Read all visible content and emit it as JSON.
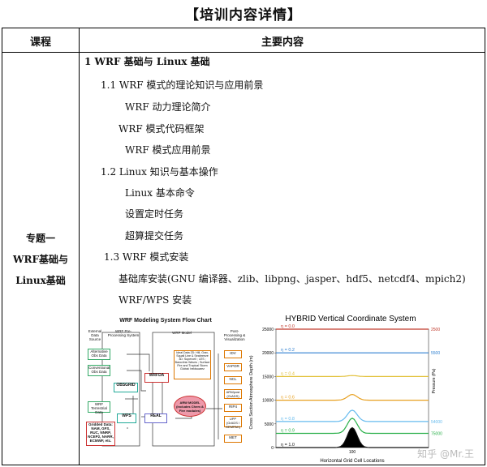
{
  "title": "【培训内容详情】",
  "table": {
    "col1_header": "课程",
    "col2_header": "主要内容",
    "course": [
      "专题一",
      "WRF基础与",
      "Linux基础"
    ],
    "lines": [
      {
        "text": "1 WRF 基础与 Linux 基础",
        "bold": true
      },
      {
        "text": "1.1 WRF 模式的理论知识与应用前景",
        "bold": false
      },
      {
        "text": "WRF 动力理论简介",
        "bold": false
      },
      {
        "text": "WRF 模式代码框架",
        "bold": false
      },
      {
        "text": "WRF 模式应用前景",
        "bold": false
      },
      {
        "text": "1.2 Linux 知识与基本操作",
        "bold": false
      },
      {
        "text": "Linux 基本命令",
        "bold": false
      },
      {
        "text": "设置定时任务",
        "bold": false
      },
      {
        "text": "超算提交任务",
        "bold": false
      },
      {
        "text": "1.3 WRF 模式安装",
        "bold": false
      },
      {
        "text": "基础库安装(GNU 编译器、zlib、libpng、jasper、hdf5、netcdf4、mpich2)",
        "bold": false
      },
      {
        "text": "WRF/WPS 安装",
        "bold": false
      }
    ]
  },
  "flowchart": {
    "title": "WRF Modeling System Flow Chart",
    "col_labels": [
      "External Data Source",
      "WRF Pre-Processing System",
      "WRF Model",
      "Post-Processing & Visualization"
    ],
    "boxes": [
      "Alternative Obs Data",
      "Conventional Obs Data",
      "WRF Terrestrial Data",
      "Gridded Data: NAM, GFS, RUC, NNRP, NCEP2, NARR, ECMWF, etc.",
      "OBSGRID",
      "WPS",
      "WRFDA",
      "REAL",
      "Ideal Data 2D: Hill, Grav, Squall Line & Seabreeze 3D: Supercell ; LES ; Baroclinic Waves ; Surface Fire and Tropical Storm Global: heldsuarez",
      "ARW MODEL (includes Chem & Fire modules)",
      "IDV",
      "VAPOR",
      "NCL",
      "ARWpost (GrADS)",
      "RIP4",
      "UPP (GrADS / GEMPAK)",
      "MET"
    ]
  },
  "chart_data": {
    "type": "line",
    "title": "HYBRID Vertical Coordinate System",
    "xlabel": "Horizontal Grid Cell Locations",
    "ylabel": "Cross Section Atmosphere Depth (m)",
    "ylabel_right": "Pressure (Pa)",
    "xlim": [
      0,
      200
    ],
    "ylim": [
      0,
      25000
    ],
    "yticks": [
      "0",
      "5000",
      "10000",
      "15000",
      "20000",
      "25000"
    ],
    "xticks": [
      "100"
    ],
    "right_ticks": [
      "2500",
      "5500",
      "",
      "",
      "54000",
      "75000"
    ],
    "series": [
      {
        "name": "η = 0.0",
        "color": "#c0392b",
        "base": 25000,
        "bump": 0
      },
      {
        "name": "η = 0.2",
        "color": "#2e7fd0",
        "base": 20000,
        "bump": 0
      },
      {
        "name": "η = 0.4",
        "color": "#e2c13a",
        "base": 15000,
        "bump": 200
      },
      {
        "name": "η = 0.6",
        "color": "#e8a020",
        "base": 10000,
        "bump": 1200
      },
      {
        "name": "η = 0.8",
        "color": "#66bbee",
        "base": 5500,
        "bump": 2400
      },
      {
        "name": "η = 0.9",
        "color": "#2ab04a",
        "base": 3000,
        "bump": 3200
      },
      {
        "name": "η = 1.0",
        "color": "#111111",
        "base": 0,
        "bump": 4200
      }
    ],
    "grid": false
  },
  "watermark": "知乎 @Mr.王"
}
